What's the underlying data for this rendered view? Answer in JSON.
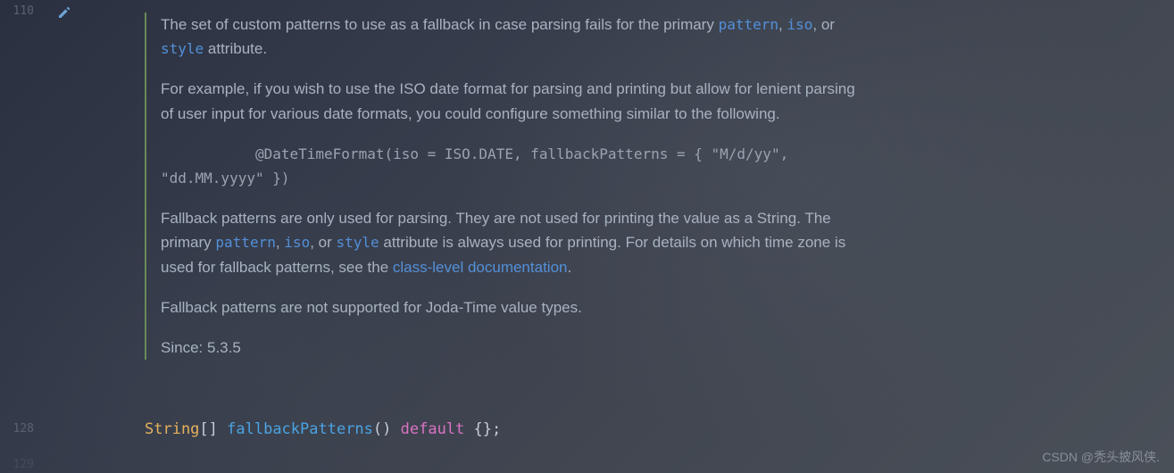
{
  "gutter": {
    "line_top": "110",
    "line_code": "128",
    "line_next": "129"
  },
  "doc": {
    "p1_a": "The set of custom patterns to use as a fallback in case parsing fails for the primary ",
    "p1_pattern": "pattern",
    "p1_b": ", ",
    "p1_iso": "iso",
    "p1_c": ", or ",
    "p1_style": "style",
    "p1_d": " attribute.",
    "p2": "For example, if you wish to use the ISO date format for parsing and printing but allow for lenient parsing of user input for various date formats, you could configure something similar to the following.",
    "code_example": "           @DateTimeFormat(iso = ISO.DATE, fallbackPatterns = { \"M/d/yy\", \"dd.MM.yyyy\" })",
    "p3_a": "Fallback patterns are only used for parsing. They are not used for printing the value as a String. The primary ",
    "p3_pattern": "pattern",
    "p3_b": ", ",
    "p3_iso": "iso",
    "p3_c": ", or ",
    "p3_style": "style",
    "p3_d": " attribute is always used for printing. For details on which time zone is used for fallback patterns, see the ",
    "p3_link": "class-level documentation",
    "p3_e": ".",
    "p4": "Fallback patterns are not supported for Joda-Time value types.",
    "since_label": "Since: ",
    "since_value": "5.3.5"
  },
  "code": {
    "type": "String",
    "brackets": "[] ",
    "method": "fallbackPatterns",
    "parens": "() ",
    "keyword": "default ",
    "braces": "{}",
    "semi": ";"
  },
  "watermark": "CSDN @秃头披风侠."
}
